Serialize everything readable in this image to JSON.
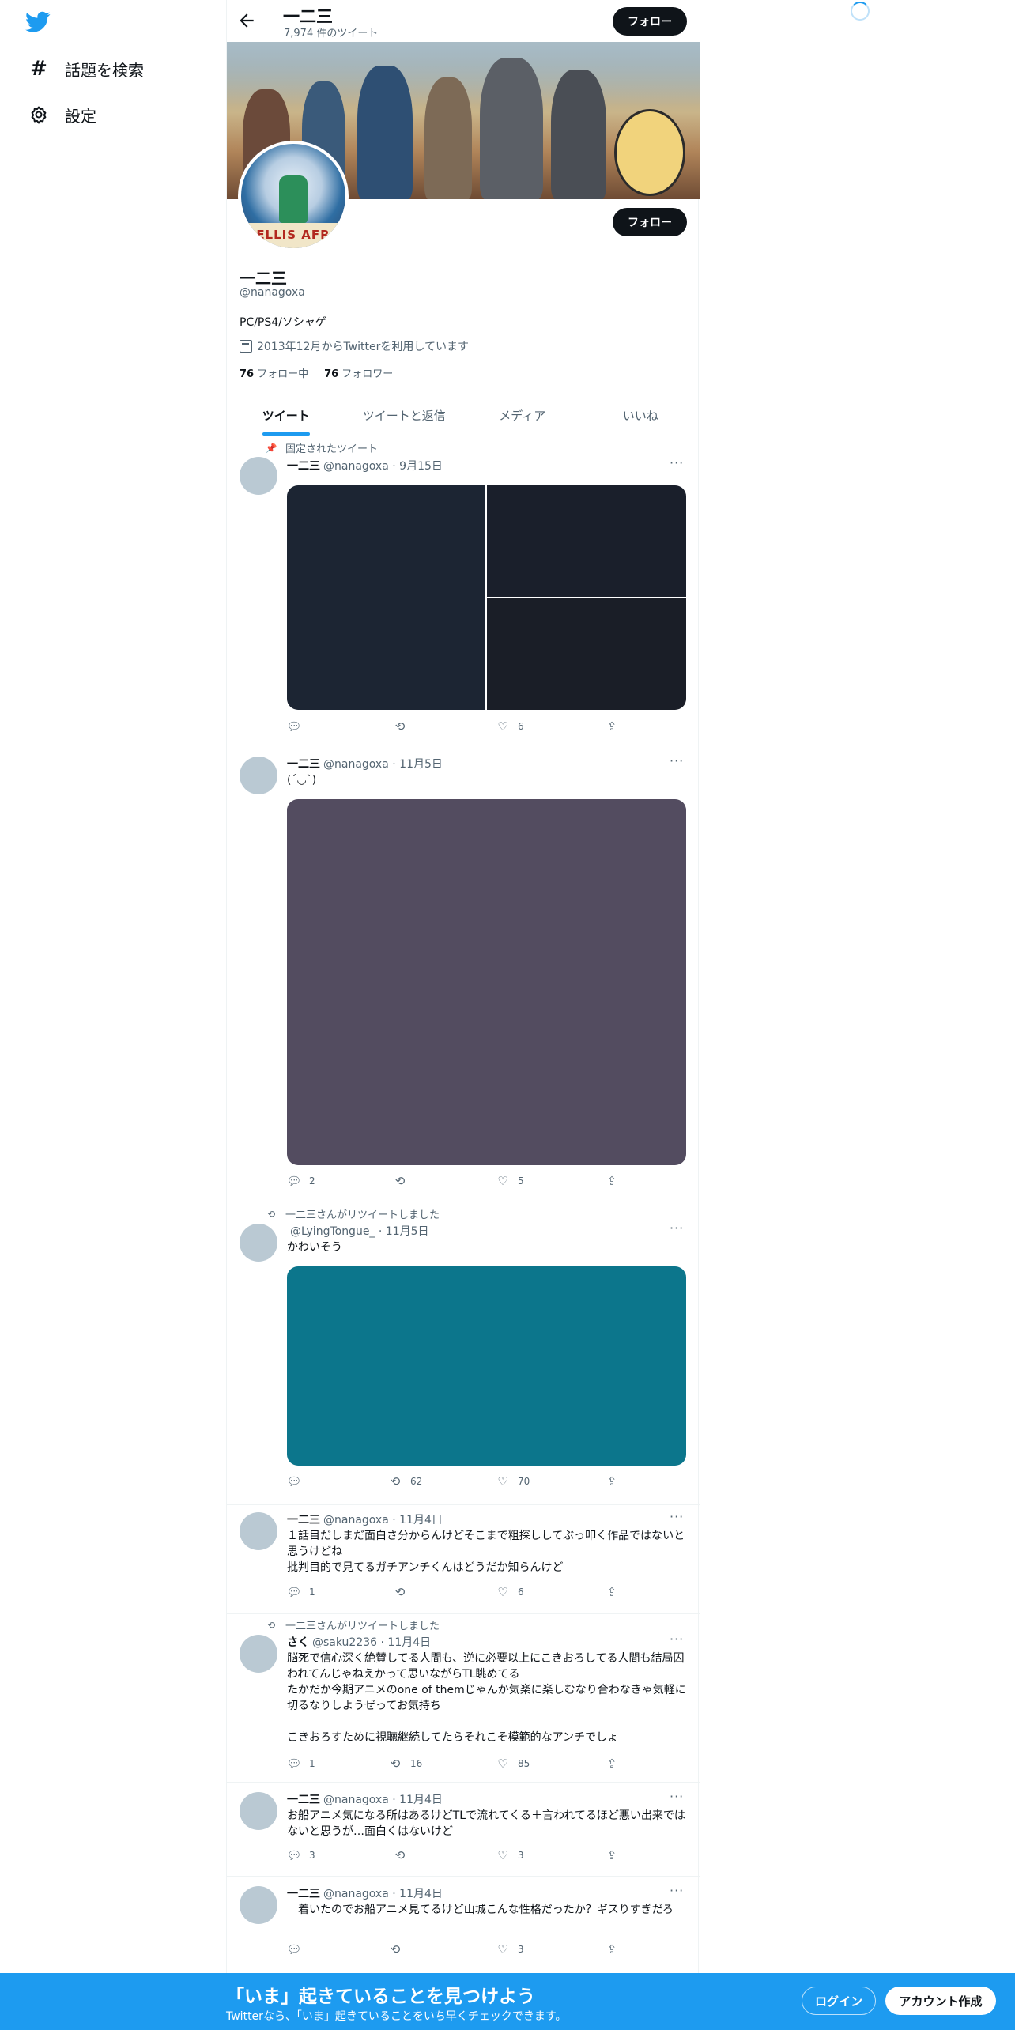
{
  "nav": {
    "items": [
      {
        "label": "話題を検索",
        "icon": "hashtag-icon"
      },
      {
        "label": "設定",
        "icon": "gear-icon"
      }
    ]
  },
  "header": {
    "title": "一二三",
    "subtitle": "7,974 件のツイート",
    "follow_label": "フォロー"
  },
  "profile": {
    "name": "一二三",
    "handle": "@nanagoxa",
    "bio": "PC/PS4/ソシャゲ",
    "joined": "2013年12月からTwitterを利用しています",
    "following_count": "76",
    "following_label": "フォロー中",
    "followers_count": "76",
    "followers_label": "フォロワー",
    "avatar_band_text": "ELLIS AFR",
    "follow_label": "フォロー"
  },
  "tabs": [
    "ツイート",
    "ツイートと返信",
    "メディア",
    "いいね"
  ],
  "tweets": [
    {
      "context": "固定されたツイート",
      "name": "一二三",
      "handle": "@nanagoxa",
      "date": "9月15日",
      "text": "",
      "reply": "",
      "retweet": "",
      "like": "6"
    },
    {
      "context": "",
      "name": "一二三",
      "handle": "@nanagoxa",
      "date": "11月5日",
      "text": "(´◡`)",
      "reply": "2",
      "retweet": "",
      "like": "5"
    },
    {
      "context": "一二三さんがリツイートしました",
      "name": "",
      "handle": "@LyingTongue_",
      "date": "11月5日",
      "text": "かわいそう",
      "reply": "",
      "retweet": "62",
      "like": "70"
    },
    {
      "context": "",
      "name": "一二三",
      "handle": "@nanagoxa",
      "date": "11月4日",
      "text": "１話目だしまだ面白さ分からんけどそこまで粗探ししてぶっ叩く作品ではないと思うけどね\n批判目的で見てるガチアンチくんはどうだか知らんけど",
      "reply": "1",
      "retweet": "",
      "like": "6"
    },
    {
      "context": "一二三さんがリツイートしました",
      "name": "さく",
      "handle": "@saku2236",
      "date": "11月4日",
      "text": "脳死で信心深く絶賛してる人間も、逆に必要以上にこきおろしてる人間も結局囚われてんじゃねえかって思いながらTL眺めてる\nたかだか今期アニメのone of themじゃんか気楽に楽しむなり合わなきゃ気軽に切るなりしようぜってお気持ち\n\nこきおろすために視聴継続してたらそれこそ模範的なアンチでしょ",
      "reply": "1",
      "retweet": "16",
      "like": "85"
    },
    {
      "context": "",
      "name": "一二三",
      "handle": "@nanagoxa",
      "date": "11月4日",
      "text": "お船アニメ気になる所はあるけどTLで流れてくる＋言われてるほど悪い出来ではないと思うが…面白くはないけど",
      "reply": "3",
      "retweet": "",
      "like": "3"
    },
    {
      "context": "",
      "name": "一二三",
      "handle": "@nanagoxa",
      "date": "11月4日",
      "text": "　着いたのでお船アニメ見てるけど山城こんな性格だったか？ギスりすぎだろ",
      "reply": "",
      "retweet": "",
      "like": "3"
    }
  ],
  "bottom": {
    "title": "「いま」起きていることを見つけよう",
    "subtitle": "Twitterなら、「いま」起きていることをいち早くチェックできます。",
    "login": "ログイン",
    "signup": "アカウント作成"
  },
  "colors": {
    "accent": "#1d9bf0",
    "media1": "#1c2533",
    "media2": "#534c60",
    "media3": "#0c768c"
  }
}
